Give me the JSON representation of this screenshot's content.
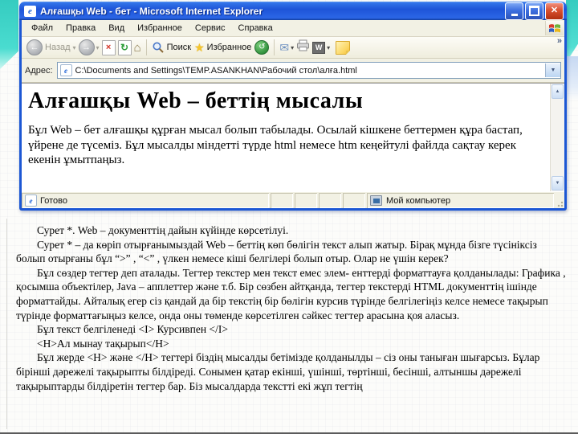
{
  "slide": {
    "accent_teal": "#3FD2C6",
    "background": "#FCFCFA"
  },
  "icons": {
    "minimize": "_",
    "maximize": "□",
    "close": "✕",
    "back_arrow": "←",
    "forward_arrow": "→",
    "stop_x": "×",
    "refresh_arrow": "↻",
    "home_glyph": "⌂",
    "star_glyph": "★",
    "history_arrow": "↺",
    "mail_glyph": "✉",
    "word_w": "W",
    "dropdown_caret": "▾",
    "scroll_up": "▲",
    "scroll_down": "▼",
    "overflow_chevron": "»",
    "ie_e": "e"
  },
  "window": {
    "title": "Алғашқы Web - бет - Microsoft Internet Explorer",
    "menu_items": [
      "Файл",
      "Правка",
      "Вид",
      "Избранное",
      "Сервис",
      "Справка"
    ],
    "toolbar": {
      "back_label": "Назад",
      "search_label": "Поиск",
      "favorites_label": "Избранное"
    },
    "address_bar": {
      "label": "Адрес:",
      "value": "C:\\Documents and Settings\\TEMP.ASANKHAN\\Рабочий стол\\алға.html"
    },
    "page_content": {
      "heading": "Алғашқы Web – беттің мысалы",
      "paragraph": "Бұл Web – бет алғашқы құрған мысал болып табылады. Осылай кішкене беттермен құра бастап, үйрене де түсеміз. Бұл мысалды міндетті түрде html немесе htm кеңейтулі файлда сақтау керек екенін ұмытпаңыз."
    },
    "status_bar": {
      "ready": "Готово",
      "zone": "Мой компьютер"
    }
  },
  "notes": {
    "paragraphs": [
      "Сурет *. Web – документтің  дайын күйінде көрсетілуі.",
      "Сурет * – да көріп отырғанымыздай  Web – беттің көп бөлігін текст алып жатыр. Бірақ мұнда бізге түсініксіз болып отырғаны бұл    “>” , “<” , үлкен немесе кіші белгілері болып отыр. Олар не үшін керек?",
      "Бұл сөздер тегтер деп аталады. Тегтер текстер мен текст емес элем- енттерді форматтауға қолданылады: Графика , қосымша объектілер, Java – апплеттер және т.б. Бір сөзбен айтқанда, тегтер текстерді HTML документтің ішінде форматтайды. Айталық егер сіз қандай да бір текстің бір бөлігін курсив түрінде белгілегіңіз келсе немесе тақырып түрінде форматтағыңыз келсе, онда оны төменде көрсетілген сәйкес тегтер арасына қоя аласыз.",
      "Бұл текст белгіленеді <I> Курсивпен </I>",
      "<H>Ал мынау тақырып</H>",
      "Бұл жерде  <H>  және  </H> тегтері біздің мысалды бетімізде қолданылды – сіз оны таныған шығарсыз. Бұлар бірінші дәрежелі тақырыпты білдіреді. Сонымен қатар екінші, үшінші, төртінші, бесінші, алтыншы дәрежелі тақырыптарды  білдіретін тегтер бар. Біз мысалдарда текстті екі жұп тегтің"
    ]
  }
}
